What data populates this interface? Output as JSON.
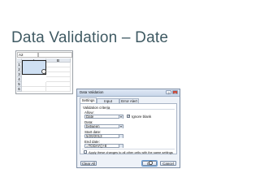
{
  "slide": {
    "title": "Data Validation – Date"
  },
  "sheet": {
    "name_box": "A2",
    "columns": [
      "A",
      "B"
    ],
    "rows": [
      "1",
      "2",
      "3",
      "4",
      "5",
      "6"
    ],
    "cell_a1": "Dates"
  },
  "dialog": {
    "title": "Data Validation",
    "tabs": [
      "Settings",
      "Input Message",
      "Error Alert"
    ],
    "criteria_heading": "Validation criteria",
    "allow_label": "Allow:",
    "allow_value": "Date",
    "ignore_blank_label": "Ignore blank",
    "ignore_blank_checked": true,
    "data_label": "Data:",
    "data_value": "between",
    "start_label": "Start date:",
    "start_value": "5/20/2013",
    "end_label": "End date:",
    "end_value": "=TODAY()+8",
    "apply_all_label": "Apply these changes to all other cells with the same settings",
    "clear_all_label": "Clear All",
    "ok_label": "OK",
    "cancel_label": "Cancel",
    "help_glyph": "?",
    "close_glyph": "×"
  }
}
